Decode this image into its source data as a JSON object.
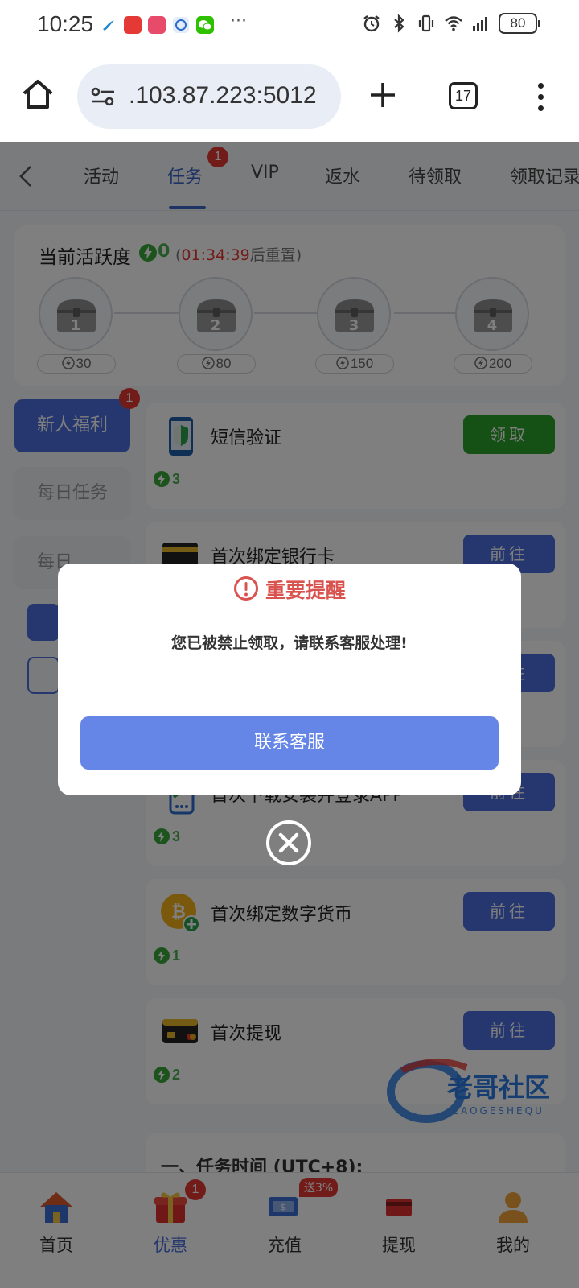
{
  "status_bar": {
    "time": "10:25",
    "more": "···",
    "battery": "80"
  },
  "browser": {
    "url": ".103.87.223:5012",
    "tab_count": "17"
  },
  "tabs": [
    {
      "label": "活动",
      "active": false
    },
    {
      "label": "任务",
      "active": true,
      "badge": "1"
    },
    {
      "label": "VIP",
      "active": false
    },
    {
      "label": "返水",
      "active": false
    },
    {
      "label": "待领取",
      "active": false
    },
    {
      "label": "领取记录",
      "active": false
    }
  ],
  "activity": {
    "title": "当前活跃度",
    "value": "0",
    "timer_open": "(",
    "timer": "01:34:39",
    "timer_suffix": "后重置)",
    "chests": [
      {
        "num": "1",
        "points": "30"
      },
      {
        "num": "2",
        "points": "80"
      },
      {
        "num": "3",
        "points": "150"
      },
      {
        "num": "4",
        "points": "200"
      }
    ]
  },
  "sidebar": [
    {
      "label": "新人福利",
      "active": true,
      "badge": "1"
    },
    {
      "label": "每日任务",
      "active": false
    },
    {
      "label": "每日",
      "active": false
    }
  ],
  "tasks": [
    {
      "title": "短信验证",
      "button": "领取",
      "points": "3",
      "icon": "phone-shield-icon",
      "color": "green"
    },
    {
      "title": "首次绑定银行卡",
      "button": "前往",
      "points": "",
      "icon": "bank-card-icon"
    },
    {
      "title": "",
      "button": "前往",
      "points": "",
      "icon": ""
    },
    {
      "title": "首次下载安装并登录APP",
      "button": "前往",
      "points": "3",
      "icon": "download-app-icon"
    },
    {
      "title": "首次绑定数字货币",
      "button": "前往",
      "points": "1",
      "icon": "bitcoin-icon"
    },
    {
      "title": "首次提现",
      "button": "前往",
      "points": "2",
      "icon": "card-withdraw-icon"
    }
  ],
  "rules": {
    "title": "一、任务时间 (UTC+8):"
  },
  "bottom_nav": [
    {
      "label": "首页",
      "icon": "home-icon"
    },
    {
      "label": "优惠",
      "icon": "gift-icon",
      "active": true,
      "badge": "1"
    },
    {
      "label": "充值",
      "icon": "recharge-icon",
      "promo": "送3%"
    },
    {
      "label": "提现",
      "icon": "withdraw-icon"
    },
    {
      "label": "我的",
      "icon": "profile-icon"
    }
  ],
  "watermark": {
    "title": "老哥社区",
    "sub": "LAOGESHEQU"
  },
  "modal": {
    "title": "重要提醒",
    "message": "您已被禁止领取，请联系客服处理!",
    "button": "联系客服"
  },
  "colors": {
    "accent": "#4a6fdc",
    "danger": "#d9534f",
    "success": "#2ba02b",
    "points": "#4caf50"
  }
}
